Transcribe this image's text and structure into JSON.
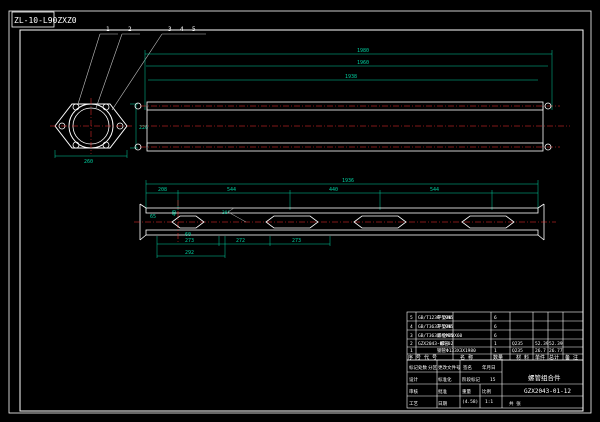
{
  "colors": {
    "background": "#000000",
    "frame": "#ffffff",
    "geometry": "#ffffff",
    "dimension": "#00d0a0",
    "centerline": "#ff3030",
    "leader": "#c0c0c0",
    "text": "#ffffff"
  },
  "title_stamp": "ZL-10-L90ZXZ0",
  "front_view": {
    "dimensions": {
      "overall": "1980",
      "middle": "1960",
      "inner": "1938"
    }
  },
  "end_view": {
    "balloons": [
      "1",
      "2",
      "3",
      "4",
      "5"
    ],
    "width_dim": "260",
    "height_dim": "226"
  },
  "section_view": {
    "top_dims": [
      "208",
      "544",
      "440",
      "544",
      "1936"
    ],
    "left_dims": [
      "65",
      "40",
      "60"
    ],
    "angle_dim": "30°",
    "bottom_dims": [
      "273",
      "272",
      "273",
      "292"
    ]
  },
  "parts_list": {
    "rows": [
      {
        "no": "5",
        "code": "GB/T1230-1995",
        "name": "平垫20",
        "qty": "6",
        "material": "",
        "unit_wt": "",
        "total_wt": "",
        "note": ""
      },
      {
        "no": "4",
        "code": "GB/T3632-1995",
        "name": "平垫20",
        "qty": "6",
        "material": "",
        "unit_wt": "",
        "total_wt": "",
        "note": ""
      },
      {
        "no": "3",
        "code": "GB/T3632-1995",
        "name": "螺栓M20X60",
        "qty": "6",
        "material": "",
        "unit_wt": "",
        "total_wt": "",
        "note": ""
      },
      {
        "no": "2",
        "code": "GZX2043-01-02",
        "name": "-螺管",
        "qty": "1",
        "material": "Q235",
        "unit_wt": "52.39",
        "total_wt": "52.39",
        "note": ""
      },
      {
        "no": "1",
        "code": "",
        "name": "钢管Φ133X3X1980",
        "qty": "1",
        "material": "Q235",
        "unit_wt": "26.7",
        "total_wt": "26.77",
        "note": ""
      }
    ],
    "header": [
      "序",
      "代号",
      "名称",
      "数量",
      "材料",
      "单件",
      "总计",
      "备注"
    ],
    "header_display": [
      "序 号",
      "代    号",
      "名    称",
      "数量",
      "材    料",
      "单件",
      "总计",
      "备  注"
    ]
  },
  "title_block": {
    "drawing_name": "螺管组合件",
    "drawing_number": "GZX2043-01-12",
    "scale_label": "比例",
    "scale_value": "1:1",
    "weight_label": "重量",
    "weight_value": "(4.58)",
    "sheet_label": "共  张",
    "sheet_index": "15",
    "row_labels": [
      "标记",
      "处数",
      "分区",
      "更改文件号",
      "签名",
      "年月日"
    ],
    "role_labels": [
      "设计",
      "审核",
      "工艺",
      "标准化",
      "批准"
    ],
    "stage_label": "阶段标记",
    "approval_label": "日期"
  }
}
